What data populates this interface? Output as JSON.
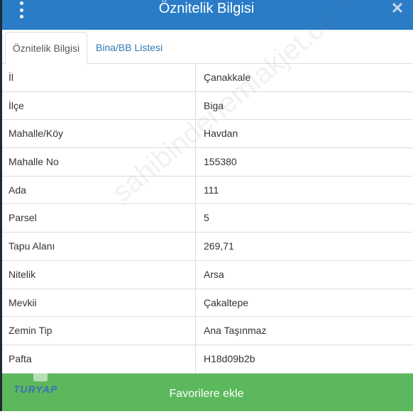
{
  "titlebar": {
    "title": "Öznitelik Bilgisi",
    "close_glyph": "✕",
    "menu_icon": "kebab-menu-icon"
  },
  "tabs": [
    {
      "label": "Öznitelik Bilgisi",
      "active": true
    },
    {
      "label": "Bina/BB Listesi",
      "active": false
    }
  ],
  "rows": [
    {
      "key": "İl",
      "value": "Çanakkale"
    },
    {
      "key": "İlçe",
      "value": "Biga"
    },
    {
      "key": "Mahalle/Köy",
      "value": "Havdan"
    },
    {
      "key": "Mahalle No",
      "value": "155380"
    },
    {
      "key": "Ada",
      "value": "111"
    },
    {
      "key": "Parsel",
      "value": "5"
    },
    {
      "key": "Tapu Alanı",
      "value": "269,71"
    },
    {
      "key": "Nitelik",
      "value": "Arsa"
    },
    {
      "key": "Mevkii",
      "value": "Çakaltepe"
    },
    {
      "key": "Zemin Tip",
      "value": "Ana Taşınmaz"
    },
    {
      "key": "Pafta",
      "value": "H18d09b2b"
    }
  ],
  "watermark": "sahibindenemlakjet.com",
  "footer": {
    "button_label": "Favorilere ekle",
    "logo_text": "TURYAP"
  },
  "colors": {
    "header": "#2a7cc7",
    "footer": "#5cb85c",
    "link": "#337ab7",
    "border": "#dddddd"
  }
}
